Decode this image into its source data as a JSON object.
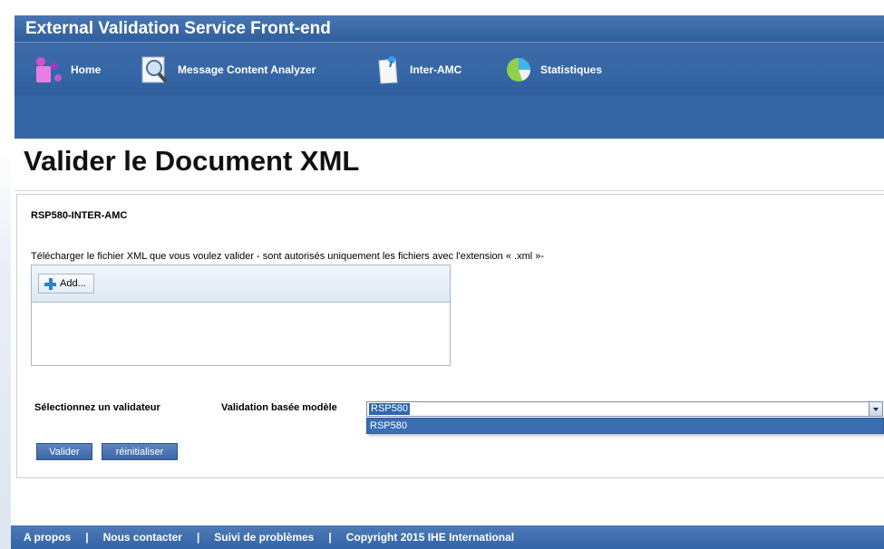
{
  "app": {
    "title": "External Validation Service Front-end"
  },
  "nav": {
    "items": [
      {
        "label": "Home",
        "icon": "home-icon"
      },
      {
        "label": "Message Content Analyzer",
        "icon": "magnifier-document-icon"
      },
      {
        "label": "Inter-AMC",
        "icon": "document-pin-icon"
      },
      {
        "label": "Statistiques",
        "icon": "pie-chart-icon"
      }
    ]
  },
  "page": {
    "title": "Valider le Document XML"
  },
  "form": {
    "service_name": "RSP580-INTER-AMC",
    "upload_label": "Télécharger le fichier XML que vous voulez valider - sont autorisés uniquement les fichiers avec l'extension « .xml »-",
    "add_label": "Add...",
    "validator_label": "Sélectionnez un validateur",
    "model_label": "Validation basée modèle",
    "selected_value": "RSP580",
    "options": [
      "RSP580"
    ],
    "validate_label": "Valider",
    "reset_label": "réinitialiser"
  },
  "footer": {
    "about": "A propos",
    "contact": "Nous contacter",
    "issues": "Suivi de problèmes",
    "copyright": "Copyright 2015 IHE International",
    "separator": "|"
  },
  "colors": {
    "header_blue": "#3566a6",
    "selection_blue": "#3165b0",
    "button_blue": "#4a74b2"
  }
}
